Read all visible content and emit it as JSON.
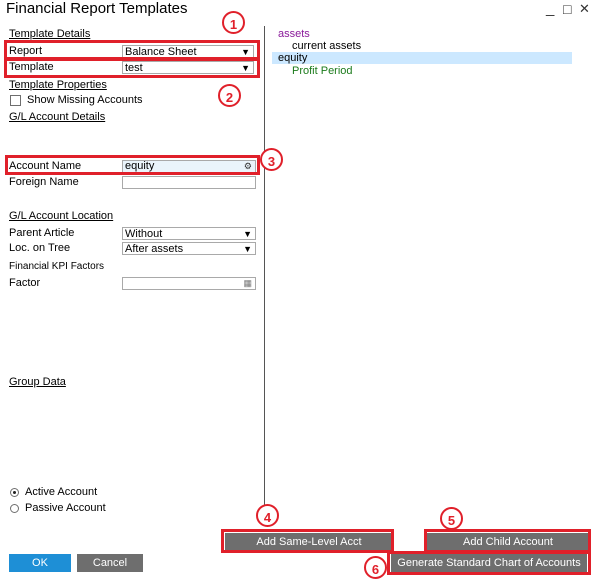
{
  "window": {
    "title": "Financial Report Templates",
    "minimize": "_",
    "maximize": "□",
    "close": "✕"
  },
  "left": {
    "template_details": "Template Details",
    "report_label": "Report",
    "report_value": "Balance Sheet",
    "template_label": "Template",
    "template_value": "test",
    "template_properties": "Template Properties",
    "show_missing": "Show Missing Accounts",
    "gl_account_details": "G/L Account Details",
    "account_name_label": "Account Name",
    "account_name_value": "equity",
    "foreign_name_label": "Foreign Name",
    "foreign_name_value": "",
    "gl_account_location": "G/L Account Location",
    "parent_article_label": "Parent Article",
    "parent_article_value": "Without",
    "loc_on_tree_label": "Loc. on Tree",
    "loc_on_tree_value": "After assets",
    "kpi_factors": "Financial KPI Factors",
    "factor_label": "Factor",
    "factor_value": "",
    "group_data": "Group Data",
    "active_account": "Active Account",
    "passive_account": "Passive Account"
  },
  "tree": {
    "items": [
      {
        "label": "assets",
        "color": "#8a1a9a"
      },
      {
        "label": "current assets",
        "color": "#000000"
      },
      {
        "label": "equity",
        "color": "#000000",
        "selected": true
      },
      {
        "label": "Profit Period",
        "color": "#1a7a1a"
      }
    ]
  },
  "buttons": {
    "ok": "OK",
    "cancel": "Cancel",
    "add_same_level": "Add Same-Level Acct",
    "add_child": "Add Child Account",
    "generate": "Generate Standard Chart of Accounts"
  },
  "annotations": [
    "1",
    "2",
    "3",
    "4",
    "5",
    "6"
  ],
  "colors": {
    "highlight": "#e0202a",
    "ok_button": "#1e8fd6",
    "button": "#6e6e6e",
    "selection": "#cce8ff"
  }
}
